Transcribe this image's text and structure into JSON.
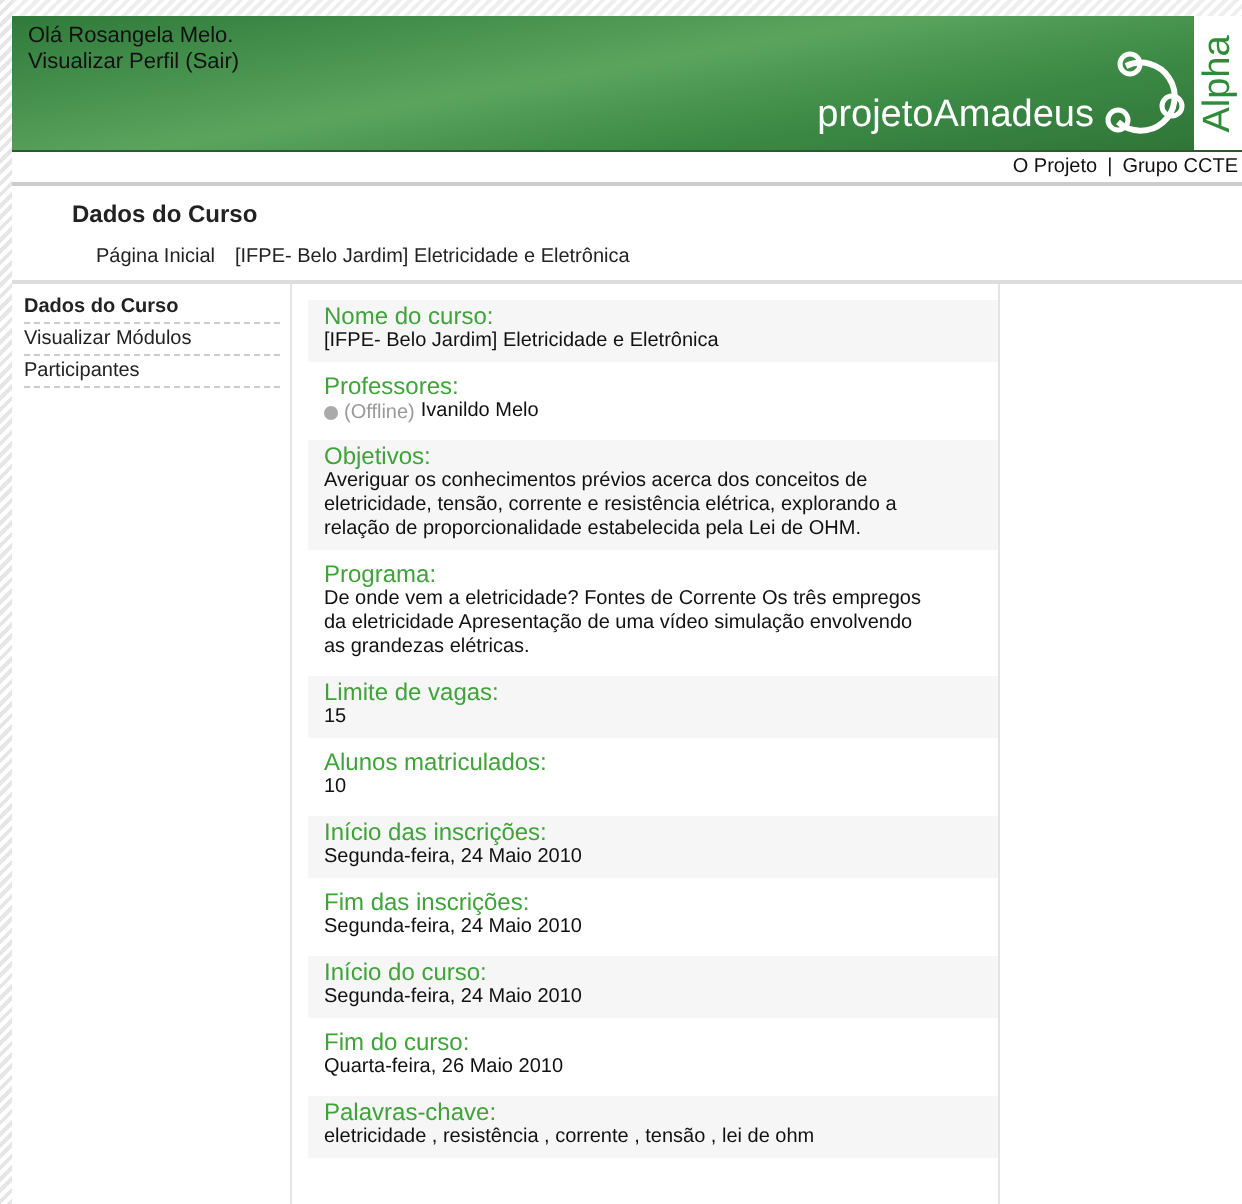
{
  "header": {
    "greeting": "Olá Rosangela Melo.",
    "profile_link": "Visualizar Perfil (Sair)",
    "logo_text": "projetoAmadeus",
    "edition": "Alpha"
  },
  "top_links": [
    "O Projeto",
    "|",
    "Grupo CCTE"
  ],
  "page_title": "Dados do Curso",
  "breadcrumb": [
    "Página Inicial",
    "[IFPE- Belo Jardim] Eletricidade e Eletrônica"
  ],
  "sidebar": {
    "items": [
      {
        "label": "Dados do Curso",
        "selected": true
      },
      {
        "label": "Visualizar Módulos",
        "selected": false
      },
      {
        "label": "Participantes",
        "selected": false
      }
    ]
  },
  "fields": [
    {
      "kind": "text",
      "label": "Nome do curso:",
      "value": "[IFPE- Belo Jardim] Eletricidade e Eletrônica"
    },
    {
      "kind": "person",
      "label": "Professores:",
      "status": "(Offline)",
      "online": false,
      "value": "Ivanildo Melo"
    },
    {
      "kind": "text",
      "label": "Objetivos:",
      "value": "Averiguar os conhecimentos prévios acerca dos conceitos de eletricidade, tensão, corrente e resistência elétrica, explorando a relação de proporcionalidade estabelecida pela Lei de OHM."
    },
    {
      "kind": "text",
      "label": "Programa:",
      "value": "De onde vem a eletricidade? Fontes de Corrente Os três empregos da eletricidade Apresentação de uma vídeo simulação envolvendo as grandezas elétricas."
    },
    {
      "kind": "text",
      "label": "Limite de vagas:",
      "value": "15"
    },
    {
      "kind": "text",
      "label": "Alunos matriculados:",
      "value": "10"
    },
    {
      "kind": "text",
      "label": "Início das inscrições:",
      "value": "Segunda-feira, 24 Maio 2010"
    },
    {
      "kind": "text",
      "label": "Fim das inscrições:",
      "value": "Segunda-feira, 24 Maio 2010"
    },
    {
      "kind": "text",
      "label": "Início do curso:",
      "value": "Segunda-feira, 24 Maio 2010"
    },
    {
      "kind": "text",
      "label": "Fim do curso:",
      "value": "Quarta-feira, 26 Maio 2010"
    },
    {
      "kind": "text",
      "label": "Palavras-chave:",
      "value": "eletricidade , resistência , corrente , tensão , lei de ohm"
    }
  ]
}
